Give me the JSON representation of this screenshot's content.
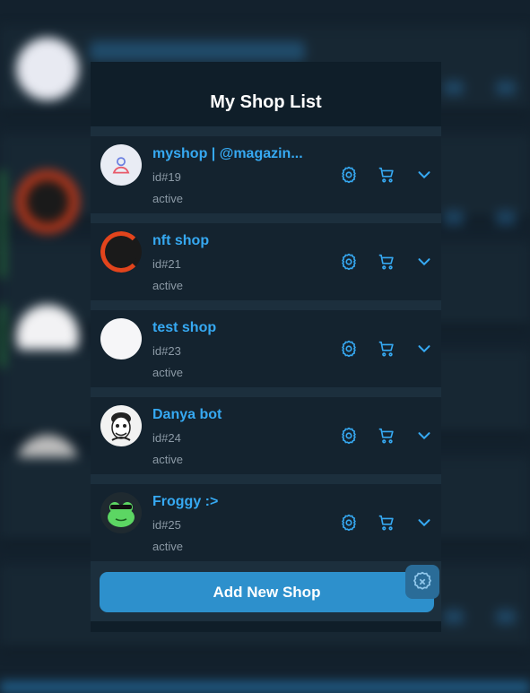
{
  "modal": {
    "title": "My Shop List",
    "add_button_label": "Add New Shop"
  },
  "shops": [
    {
      "name": "myshop | @magazin...",
      "id": "id#19",
      "status": "active",
      "avatar": "person-placeholder-icon"
    },
    {
      "name": "nft shop",
      "id": "id#21",
      "status": "active",
      "avatar": "orange-ring-avatar"
    },
    {
      "name": "test shop",
      "id": "id#23",
      "status": "active",
      "avatar": "white-avatar"
    },
    {
      "name": "Danya bot",
      "id": "id#24",
      "status": "active",
      "avatar": "sketch-avatar"
    },
    {
      "name": "Froggy :>",
      "id": "id#25",
      "status": "active",
      "avatar": "frog-avatar"
    }
  ],
  "icons": {
    "row_actions": [
      "gear-icon",
      "cart-icon",
      "chevron-down-icon"
    ],
    "fab": "gear-x-icon"
  },
  "colors": {
    "accent": "#36a9f2",
    "button": "#2d90cc",
    "panel": "#0f1e29",
    "row": "#14232f",
    "muted": "#8c9aa6"
  }
}
